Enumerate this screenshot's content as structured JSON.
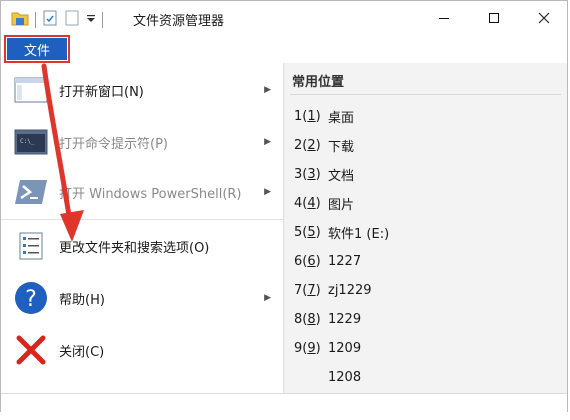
{
  "window": {
    "title": "文件资源管理器"
  },
  "tab": {
    "file_label": "文件"
  },
  "menu": {
    "items": [
      {
        "label": "打开新窗口(N)",
        "icon": "new-window-icon",
        "has_submenu": true,
        "disabled": false
      },
      {
        "label": "打开命令提示符(P)",
        "icon": "cmd-icon",
        "has_submenu": true,
        "disabled": true
      },
      {
        "label": "打开 Windows PowerShell(R)",
        "icon": "powershell-icon",
        "has_submenu": true,
        "disabled": true
      },
      {
        "label": "更改文件夹和搜索选项(O)",
        "icon": "options-icon",
        "has_submenu": false,
        "disabled": false
      },
      {
        "label": "帮助(H)",
        "icon": "help-icon",
        "has_submenu": true,
        "disabled": false
      },
      {
        "label": "关闭(C)",
        "icon": "close-x-icon",
        "has_submenu": false,
        "disabled": false
      }
    ]
  },
  "recent": {
    "heading": "常用位置",
    "items": [
      {
        "num": "1",
        "key": "1",
        "name": "桌面"
      },
      {
        "num": "2",
        "key": "2",
        "name": "下载"
      },
      {
        "num": "3",
        "key": "3",
        "name": "文档"
      },
      {
        "num": "4",
        "key": "4",
        "name": "图片"
      },
      {
        "num": "5",
        "key": "5",
        "name": "软件1 (E:)"
      },
      {
        "num": "6",
        "key": "6",
        "name": "1227"
      },
      {
        "num": "7",
        "key": "7",
        "name": "zj1229"
      },
      {
        "num": "8",
        "key": "8",
        "name": "1229"
      },
      {
        "num": "9",
        "key": "9",
        "name": "1209"
      },
      {
        "num": "",
        "key": "",
        "name": "1208"
      }
    ]
  },
  "colors": {
    "accent": "#1f5fbf",
    "highlight_box": "#e0352b",
    "annotation_arrow": "#e0352b"
  }
}
